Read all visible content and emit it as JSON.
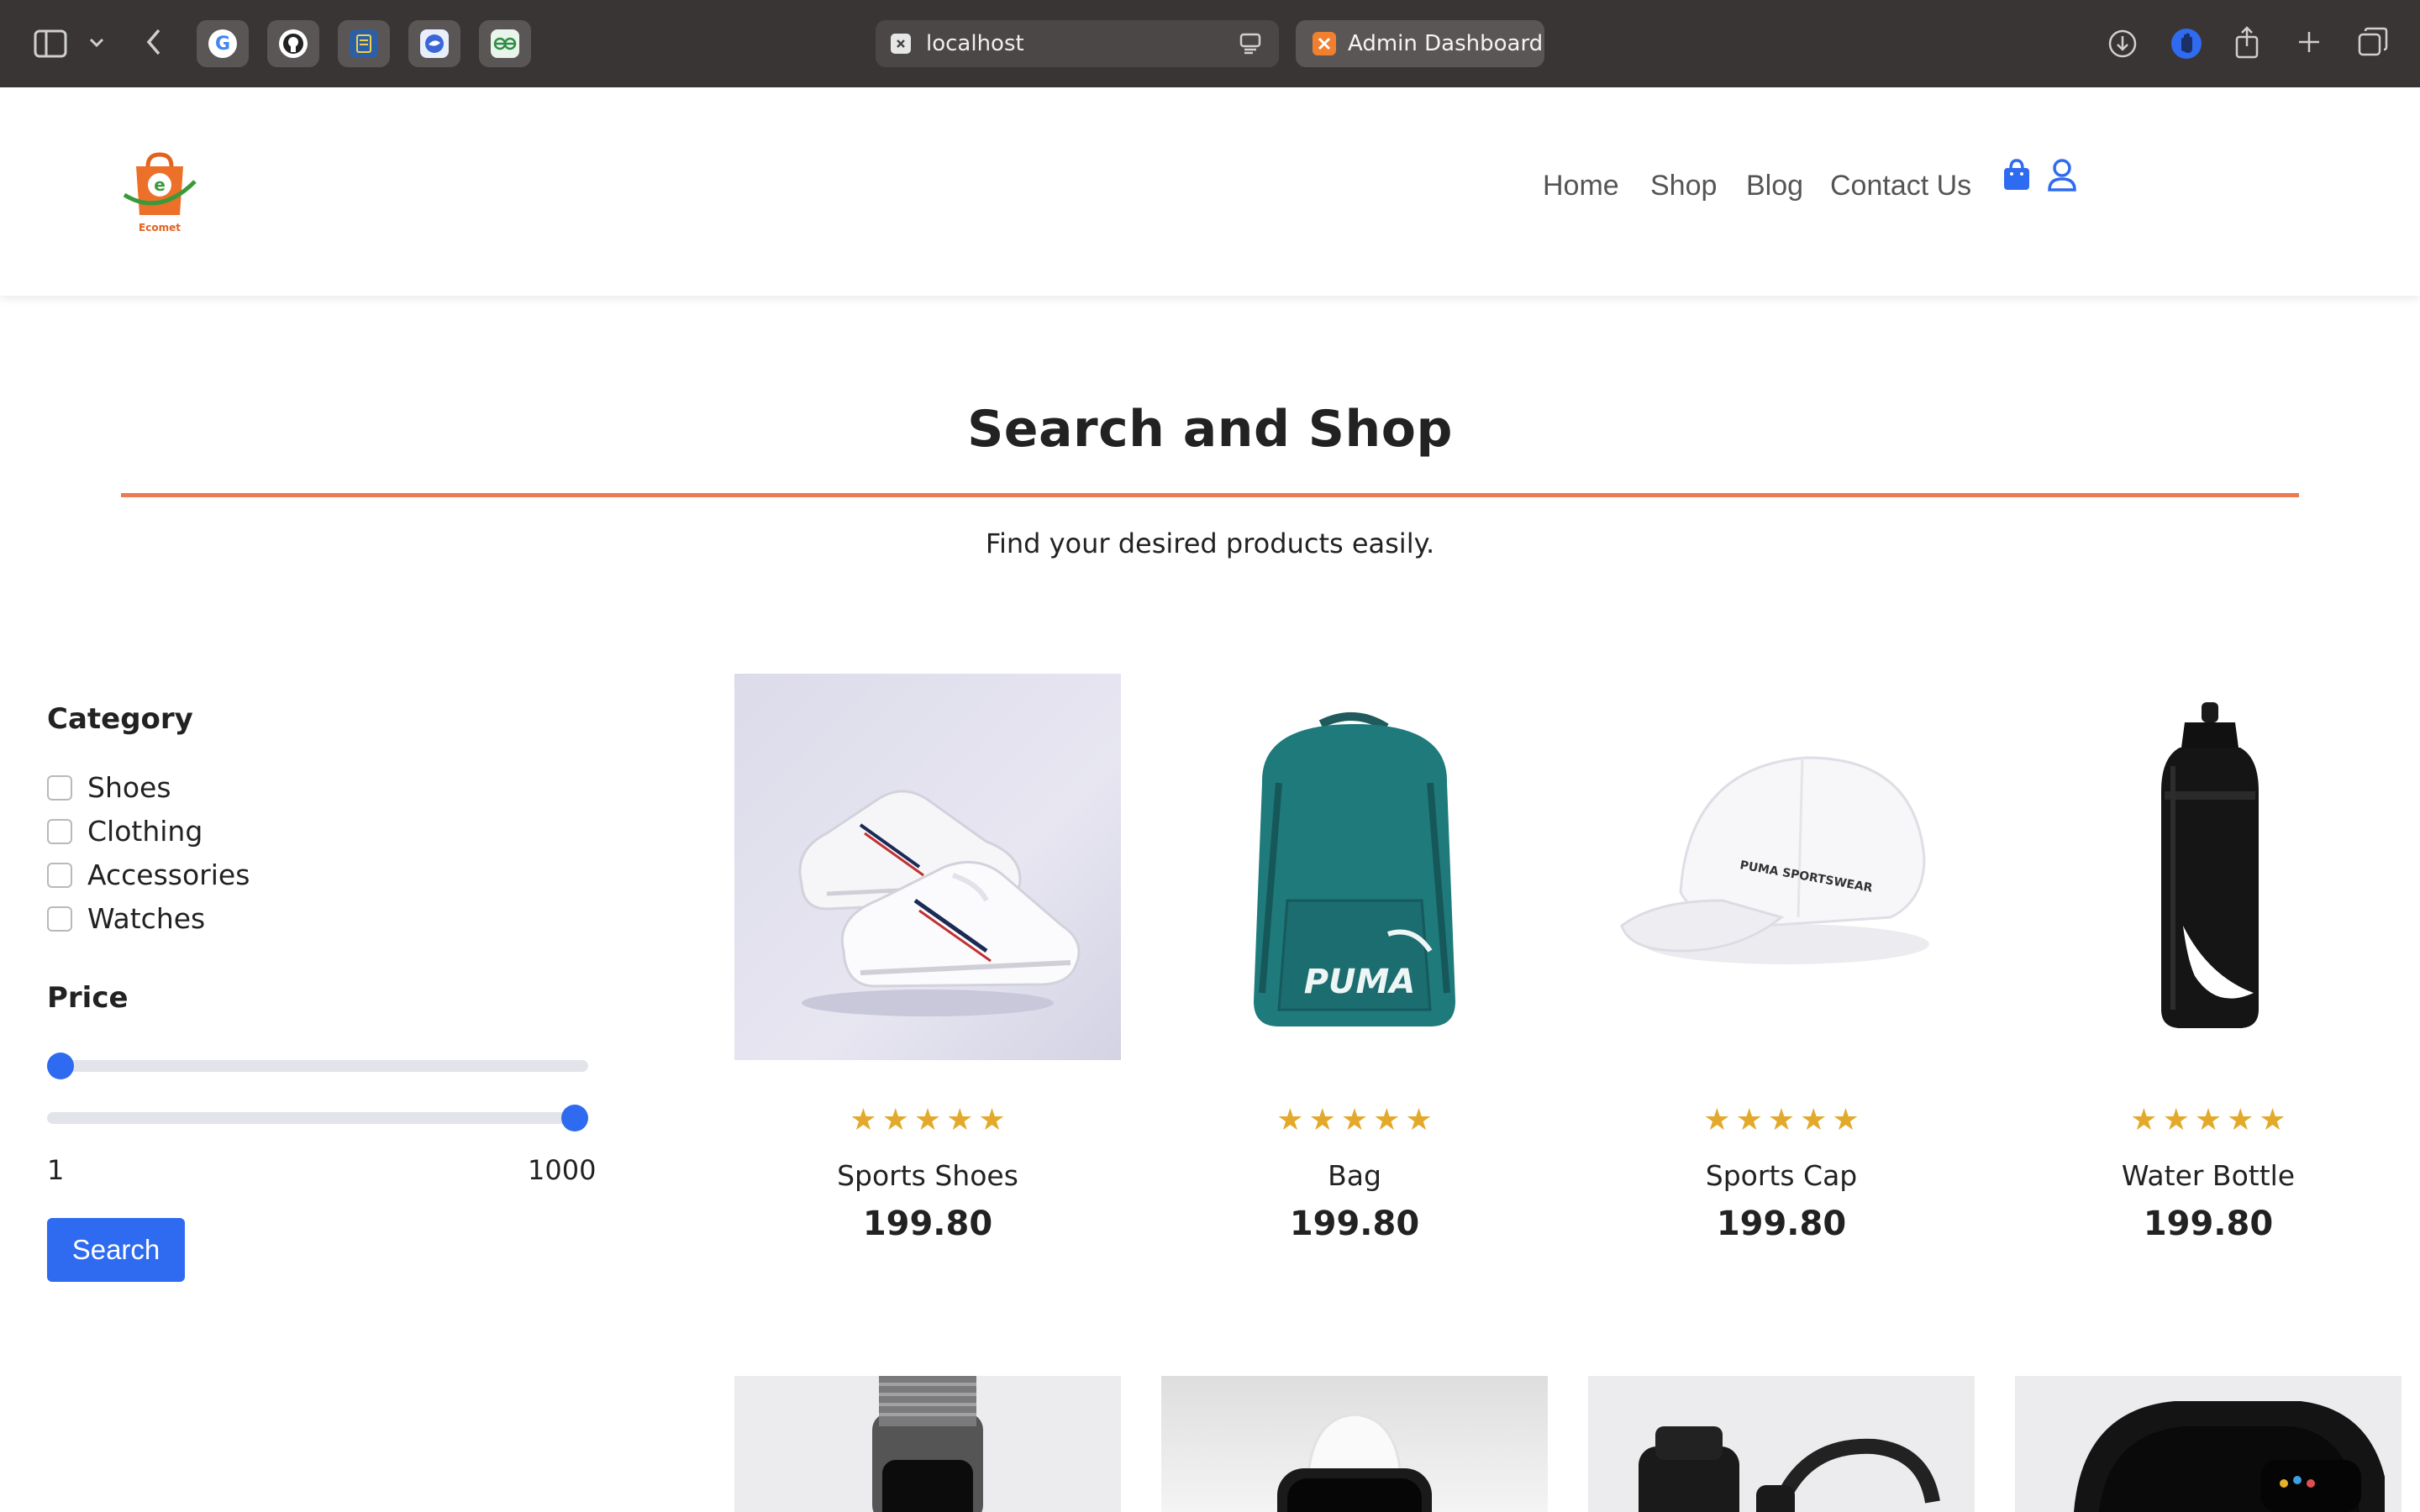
{
  "browser": {
    "url_text": "localhost",
    "tab_title": "Admin Dashboard"
  },
  "header": {
    "logo_text": "Ecomet",
    "nav": [
      {
        "label": "Home"
      },
      {
        "label": "Shop"
      },
      {
        "label": "Blog"
      },
      {
        "label": "Contact Us"
      }
    ]
  },
  "hero": {
    "title": "Search and Shop",
    "subtitle": "Find your desired products easily.",
    "accent_color": "#ec7a52"
  },
  "filters": {
    "category_title": "Category",
    "categories": [
      {
        "label": "Shoes",
        "checked": false
      },
      {
        "label": "Clothing",
        "checked": false
      },
      {
        "label": "Accessories",
        "checked": false
      },
      {
        "label": "Watches",
        "checked": false
      }
    ],
    "price_title": "Price",
    "min_value": "1",
    "max_value": "1000",
    "search_label": "Search",
    "accent_color": "#2f6bf0"
  },
  "products": [
    {
      "name": "Sports Shoes",
      "price": "199.80",
      "rating": 5
    },
    {
      "name": "Bag",
      "price": "199.80",
      "rating": 5
    },
    {
      "name": "Sports Cap",
      "price": "199.80",
      "rating": 5
    },
    {
      "name": "Water Bottle",
      "price": "199.80",
      "rating": 5
    }
  ],
  "star_color": "#e3a92a"
}
